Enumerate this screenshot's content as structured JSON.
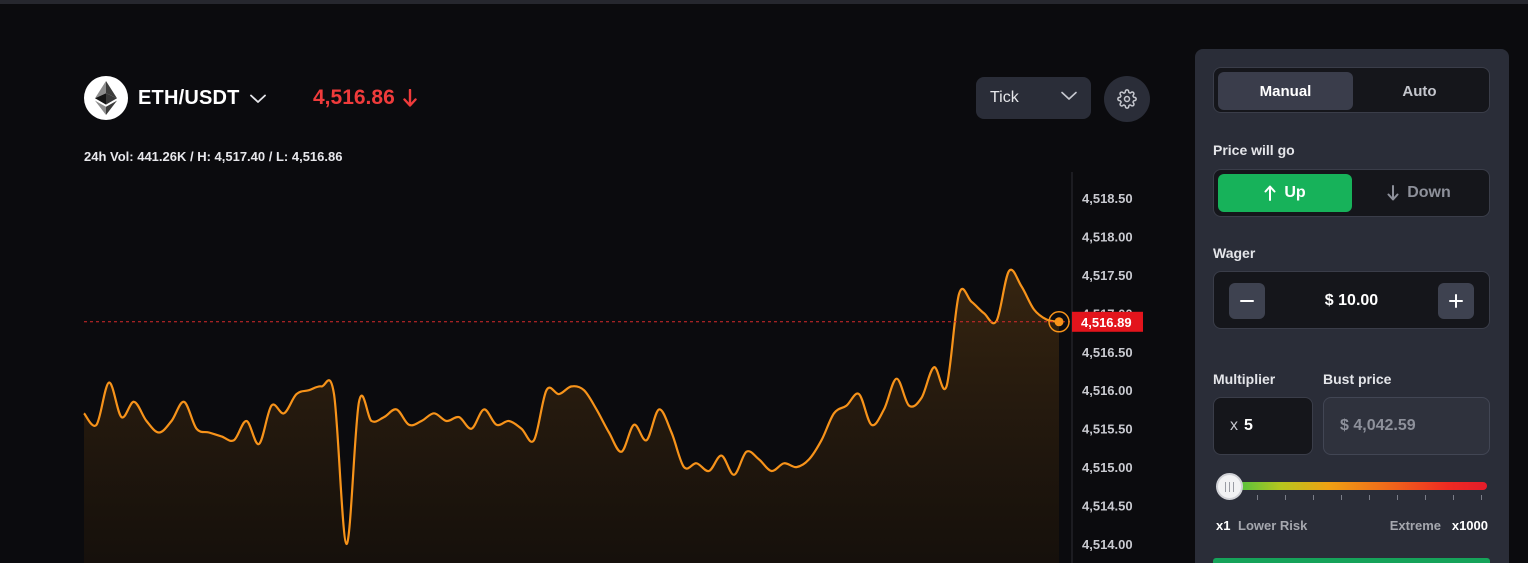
{
  "header": {
    "pair": "ETH/USDT",
    "price": "4,516.86",
    "price_color": "#ef3b3b",
    "price_direction_icon": "arrow-down-icon",
    "stats": "24h Vol: 441.26K / H: 4,517.40 / L: 4,516.86",
    "interval_select": "Tick",
    "settings_icon": "gear-icon"
  },
  "chart_data": {
    "type": "area",
    "line_color": "#f7931a",
    "y_axis_ticks": [
      "4,518.50",
      "4,518.00",
      "4,517.50",
      "4,517.00",
      "4,516.50",
      "4,516.00",
      "4,515.50",
      "4,515.00",
      "4,514.50",
      "4,514.00"
    ],
    "ylim": [
      4514.0,
      4518.5
    ],
    "current_price_label": "4,516.89",
    "current_price": 4516.89,
    "reference_line": "dashed-red at current price",
    "values": [
      4515.7,
      4515.55,
      4516.1,
      4515.65,
      4515.85,
      4515.6,
      4515.45,
      4515.6,
      4515.85,
      4515.5,
      4515.45,
      4515.4,
      4515.35,
      4515.6,
      4515.3,
      4515.8,
      4515.7,
      4515.95,
      4516.0,
      4516.05,
      4515.95,
      4514.0,
      4515.85,
      4515.6,
      4515.65,
      4515.75,
      4515.55,
      4515.6,
      4515.7,
      4515.6,
      4515.65,
      4515.5,
      4515.75,
      4515.55,
      4515.6,
      4515.5,
      4515.35,
      4516.0,
      4515.95,
      4516.05,
      4516.0,
      4515.75,
      4515.45,
      4515.2,
      4515.55,
      4515.35,
      4515.75,
      4515.45,
      4515.0,
      4515.05,
      4514.95,
      4515.15,
      4514.9,
      4515.2,
      4515.1,
      4514.95,
      4515.05,
      4515.0,
      4515.1,
      4515.35,
      4515.7,
      4515.8,
      4515.95,
      4515.55,
      4515.75,
      4516.15,
      4515.8,
      4515.9,
      4516.3,
      4516.05,
      4517.25,
      4517.15,
      4517.0,
      4516.9,
      4517.55,
      4517.35,
      4517.05,
      4516.92,
      4516.89
    ]
  },
  "panel": {
    "mode_tabs": [
      "Manual",
      "Auto"
    ],
    "active_mode": "Manual",
    "direction_label": "Price will go",
    "direction_up": "Up",
    "direction_down": "Down",
    "direction_selected": "Up",
    "up_color": "#17b25a",
    "wager_label": "Wager",
    "wager_value": "$ 10.00",
    "multiplier_label": "Multiplier",
    "multiplier_prefix": "x",
    "multiplier_value": "5",
    "bust_price_label": "Bust price",
    "bust_price_value": "$ 4,042.59",
    "risk_min": "x1",
    "risk_min_label": "Lower Risk",
    "risk_max_label": "Extreme",
    "risk_max": "x1000",
    "risk_level_fraction": 0.0
  }
}
